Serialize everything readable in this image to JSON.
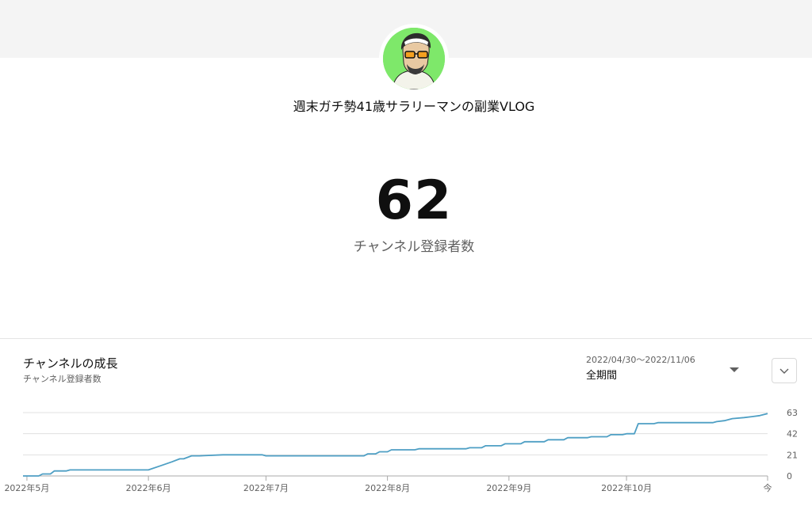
{
  "channel": {
    "name": "週末ガチ勢41歳サラリーマンの副業VLOG",
    "subscriber_count": "62",
    "subscriber_label": "チャンネル登録者数"
  },
  "chart_panel": {
    "title": "チャンネルの成長",
    "subtitle": "チャンネル登録者数",
    "date_range": "2022/04/30〜2022/11/06",
    "period_label": "全期間",
    "period_icon": "caret-down-icon",
    "expand_icon": "chevron-down-icon"
  },
  "colors": {
    "line": "#4e9fc4",
    "grid": "#e0e0e0",
    "baseline": "#a8a8a8",
    "tick_text": "#606060",
    "avatar_bg": "#7ee86a"
  },
  "chart_data": {
    "type": "line",
    "title": "チャンネルの成長",
    "subtitle": "チャンネル登録者数",
    "xlabel": "",
    "ylabel": "",
    "y_ticks": [
      0,
      21,
      42,
      63
    ],
    "ylim": [
      0,
      63
    ],
    "x_domain": [
      "2022-04-30",
      "2022-11-06"
    ],
    "x_ticks": [
      {
        "date": "2022-05-01",
        "label": "2022年5月"
      },
      {
        "date": "2022-06-01",
        "label": "2022年6月"
      },
      {
        "date": "2022-07-01",
        "label": "2022年7月"
      },
      {
        "date": "2022-08-01",
        "label": "2022年8月"
      },
      {
        "date": "2022-09-01",
        "label": "2022年9月"
      },
      {
        "date": "2022-10-01",
        "label": "2022年10月"
      },
      {
        "date": "2022-11-06",
        "label": "今"
      }
    ],
    "grid": true,
    "legend": "none",
    "series": [
      {
        "points": [
          [
            "2022-04-30",
            0
          ],
          [
            "2022-05-04",
            0
          ],
          [
            "2022-05-05",
            2
          ],
          [
            "2022-05-07",
            2
          ],
          [
            "2022-05-08",
            5
          ],
          [
            "2022-05-11",
            5
          ],
          [
            "2022-05-12",
            6
          ],
          [
            "2022-06-01",
            6
          ],
          [
            "2022-06-04",
            10
          ],
          [
            "2022-06-07",
            14
          ],
          [
            "2022-06-09",
            17
          ],
          [
            "2022-06-10",
            17
          ],
          [
            "2022-06-12",
            20
          ],
          [
            "2022-06-14",
            20
          ],
          [
            "2022-06-20",
            21
          ],
          [
            "2022-06-30",
            21
          ],
          [
            "2022-07-01",
            20
          ],
          [
            "2022-07-26",
            20
          ],
          [
            "2022-07-27",
            22
          ],
          [
            "2022-07-29",
            22
          ],
          [
            "2022-07-30",
            24
          ],
          [
            "2022-08-01",
            24
          ],
          [
            "2022-08-02",
            26
          ],
          [
            "2022-08-08",
            26
          ],
          [
            "2022-08-09",
            27
          ],
          [
            "2022-08-21",
            27
          ],
          [
            "2022-08-22",
            28
          ],
          [
            "2022-08-25",
            28
          ],
          [
            "2022-08-26",
            30
          ],
          [
            "2022-08-30",
            30
          ],
          [
            "2022-08-31",
            32
          ],
          [
            "2022-09-04",
            32
          ],
          [
            "2022-09-05",
            34
          ],
          [
            "2022-09-10",
            34
          ],
          [
            "2022-09-11",
            36
          ],
          [
            "2022-09-15",
            36
          ],
          [
            "2022-09-16",
            38
          ],
          [
            "2022-09-21",
            38
          ],
          [
            "2022-09-22",
            39
          ],
          [
            "2022-09-26",
            39
          ],
          [
            "2022-09-27",
            41
          ],
          [
            "2022-09-30",
            41
          ],
          [
            "2022-10-01",
            42
          ],
          [
            "2022-10-03",
            42
          ],
          [
            "2022-10-04",
            52
          ],
          [
            "2022-10-08",
            52
          ],
          [
            "2022-10-09",
            53
          ],
          [
            "2022-10-23",
            53
          ],
          [
            "2022-10-24",
            54
          ],
          [
            "2022-10-26",
            55
          ],
          [
            "2022-10-28",
            57
          ],
          [
            "2022-10-31",
            58
          ],
          [
            "2022-11-02",
            59
          ],
          [
            "2022-11-04",
            60
          ],
          [
            "2022-11-06",
            62
          ]
        ]
      }
    ]
  }
}
